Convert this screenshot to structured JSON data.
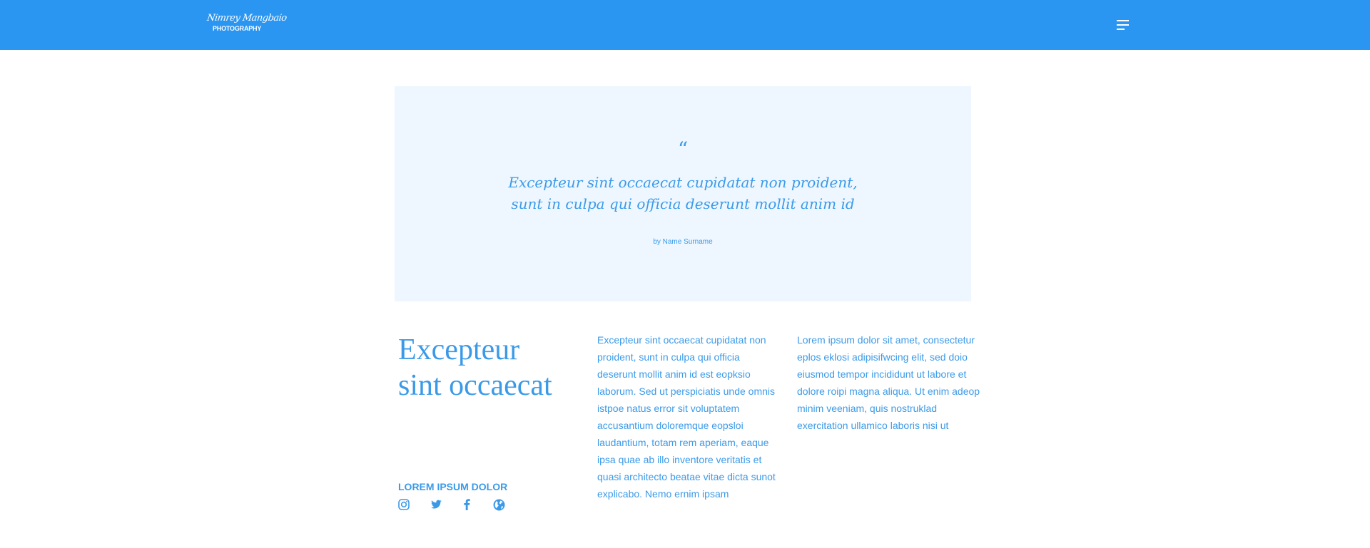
{
  "header": {
    "logo_script": "Nimrey Mangbaio",
    "logo_subtitle": "PHOTOGRAPHY",
    "menu_icon": "hamburger-menu-icon",
    "background_color": "#2b96f2"
  },
  "quote": {
    "mark": "“",
    "line1": "Excepteur sint occaecat cupidatat non proident,",
    "line2": "sunt in culpa qui officia deserunt mollit anim id",
    "author": "by Name Surname",
    "background_color": "#eef7ff"
  },
  "feature": {
    "heading_line1": "Excepteur",
    "heading_line2": "sint occaecat",
    "social_title": "LOREM IPSUM DOLOR",
    "social_icons": [
      "instagram-icon",
      "twitter-icon",
      "facebook-icon",
      "globe-icon"
    ]
  },
  "columns": [
    {
      "text": "Excepteur sint occaecat cupidatat non proident, sunt in culpa qui officia deserunt mollit anim id est eopksio laborum. Sed ut perspiciatis unde omnis istpoe natus error sit voluptatem accusantium doloremque eopsloi laudantium, totam rem aperiam, eaque ipsa quae ab illo inventore veritatis et quasi architecto beatae vitae dicta sunot explicabo. Nemo ernim ipsam"
    },
    {
      "text": "Lorem ipsum dolor sit amet, consectetur eplos eklosi adipisifwcing elit, sed doio eiusmod tempor incididunt ut labore et dolore roipi magna aliqua. Ut enim adeop minim veeniam, quis nostruklad exercitation ullamico laboris nisi ut"
    }
  ],
  "colors": {
    "accent": "#3b9ae8",
    "header": "#2b96f2",
    "quote_bg": "#eef7ff"
  }
}
